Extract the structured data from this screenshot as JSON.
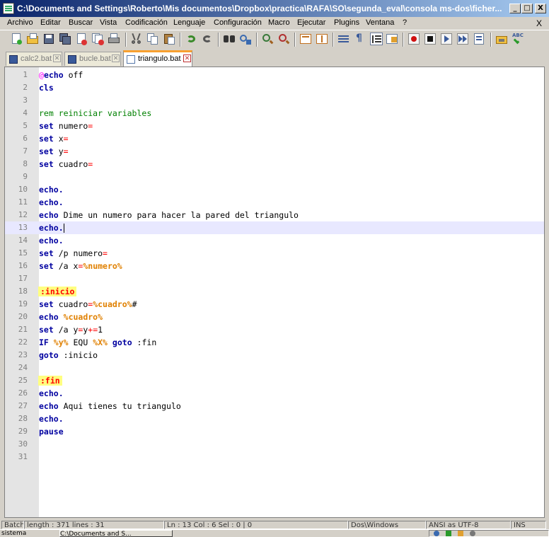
{
  "window": {
    "title": "C:\\Documents and Settings\\Roberto\\Mis documentos\\Dropbox\\practica\\RAFA\\SO\\segunda_eval\\consola ms-dos\\ficher...",
    "min_label": "_",
    "max_label": "□",
    "close_label": "X"
  },
  "menu": {
    "items": [
      "Archivo",
      "Editar",
      "Buscar",
      "Vista",
      "Codificación",
      "Lenguaje",
      "Configuración",
      "Macro",
      "Ejecutar",
      "Plugins",
      "Ventana",
      "?"
    ],
    "doc_close": "X"
  },
  "tabs": [
    {
      "label": "calc2.bat",
      "active": false
    },
    {
      "label": "bucle.bat",
      "active": false
    },
    {
      "label": "triangulo.bat",
      "active": true
    }
  ],
  "tab_close_glyph": "✕",
  "editor": {
    "current_line": 13,
    "lines": [
      [
        [
          "at",
          "@"
        ],
        [
          "kw",
          "echo"
        ],
        [
          "t",
          " off"
        ]
      ],
      [
        [
          "kw",
          "cls"
        ]
      ],
      [],
      [
        [
          "cmt",
          "rem reiniciar variables"
        ]
      ],
      [
        [
          "kw",
          "set"
        ],
        [
          "t",
          " numero"
        ],
        [
          "op",
          "="
        ]
      ],
      [
        [
          "kw",
          "set"
        ],
        [
          "t",
          " x"
        ],
        [
          "op",
          "="
        ]
      ],
      [
        [
          "kw",
          "set"
        ],
        [
          "t",
          " y"
        ],
        [
          "op",
          "="
        ]
      ],
      [
        [
          "kw",
          "set"
        ],
        [
          "t",
          " cuadro"
        ],
        [
          "op",
          "="
        ]
      ],
      [],
      [
        [
          "kw",
          "echo."
        ]
      ],
      [
        [
          "kw",
          "echo."
        ]
      ],
      [
        [
          "kw",
          "echo"
        ],
        [
          "t",
          " Dime un numero para hacer la pared del triangulo"
        ]
      ],
      [
        [
          "kw",
          "echo."
        ],
        [
          "caret",
          ""
        ]
      ],
      [
        [
          "kw",
          "echo."
        ]
      ],
      [
        [
          "kw",
          "set"
        ],
        [
          "t",
          " /p numero"
        ],
        [
          "op",
          "="
        ]
      ],
      [
        [
          "kw",
          "set"
        ],
        [
          "t",
          " /a x"
        ],
        [
          "op",
          "="
        ],
        [
          "var",
          "%numero%"
        ]
      ],
      [],
      [
        [
          "lbl",
          ":inicio"
        ]
      ],
      [
        [
          "kw",
          "set"
        ],
        [
          "t",
          " cuadro"
        ],
        [
          "op",
          "="
        ],
        [
          "var",
          "%cuadro%"
        ],
        [
          "t",
          "#"
        ]
      ],
      [
        [
          "kw",
          "echo"
        ],
        [
          "t",
          " "
        ],
        [
          "var",
          "%cuadro%"
        ]
      ],
      [
        [
          "kw",
          "set"
        ],
        [
          "t",
          " /a y"
        ],
        [
          "op",
          "="
        ],
        [
          "t",
          "y"
        ],
        [
          "op",
          "+="
        ],
        [
          "t",
          "1"
        ]
      ],
      [
        [
          "kw",
          "IF"
        ],
        [
          "t",
          " "
        ],
        [
          "var",
          "%y%"
        ],
        [
          "t",
          " EQU "
        ],
        [
          "var",
          "%X%"
        ],
        [
          "t",
          " "
        ],
        [
          "kw",
          "goto"
        ],
        [
          "t",
          " :fin"
        ]
      ],
      [
        [
          "kw",
          "goto"
        ],
        [
          "t",
          " :inicio"
        ]
      ],
      [],
      [
        [
          "lbl",
          ":fin"
        ]
      ],
      [
        [
          "kw",
          "echo."
        ]
      ],
      [
        [
          "kw",
          "echo"
        ],
        [
          "t",
          " Aqui tienes tu triangulo"
        ]
      ],
      [
        [
          "kw",
          "echo."
        ]
      ],
      [
        [
          "kw",
          "pause"
        ]
      ],
      [],
      []
    ]
  },
  "status": {
    "type": "Batch",
    "length": "length : 371    lines : 31",
    "position": "Ln : 13    Col : 6    Sel : 0 | 0",
    "eol": "Dos\\Windows",
    "encoding": "ANSI as UTF-8",
    "mode": "INS"
  },
  "taskbar": {
    "start_fragment": "sistema",
    "window_button": "C:\\Documents and S..."
  },
  "colors": {
    "keyword": "#0000a0",
    "operator": "#ff0000",
    "variable": "#e08000",
    "comment": "#008000",
    "label_bg": "#ffff80",
    "active_tab_accent": "#f8a030",
    "current_line": "#e8e8ff"
  },
  "toolbar_icons": [
    "new-file-icon",
    "open-file-icon",
    "save-icon",
    "save-all-icon",
    "close-icon",
    "close-all-icon",
    "print-icon",
    "cut-icon",
    "copy-icon",
    "paste-icon",
    "undo-icon",
    "redo-icon",
    "find-icon",
    "replace-icon",
    "zoom-in-icon",
    "zoom-out-icon",
    "sync-v-icon",
    "sync-h-icon",
    "word-wrap-icon",
    "show-all-chars-icon",
    "indent-guide-icon",
    "doc-map-icon",
    "record-macro-icon",
    "stop-macro-icon",
    "play-macro-icon",
    "run-macro-multiple-icon",
    "save-macro-icon",
    "folder-icon",
    "spellcheck-icon"
  ]
}
